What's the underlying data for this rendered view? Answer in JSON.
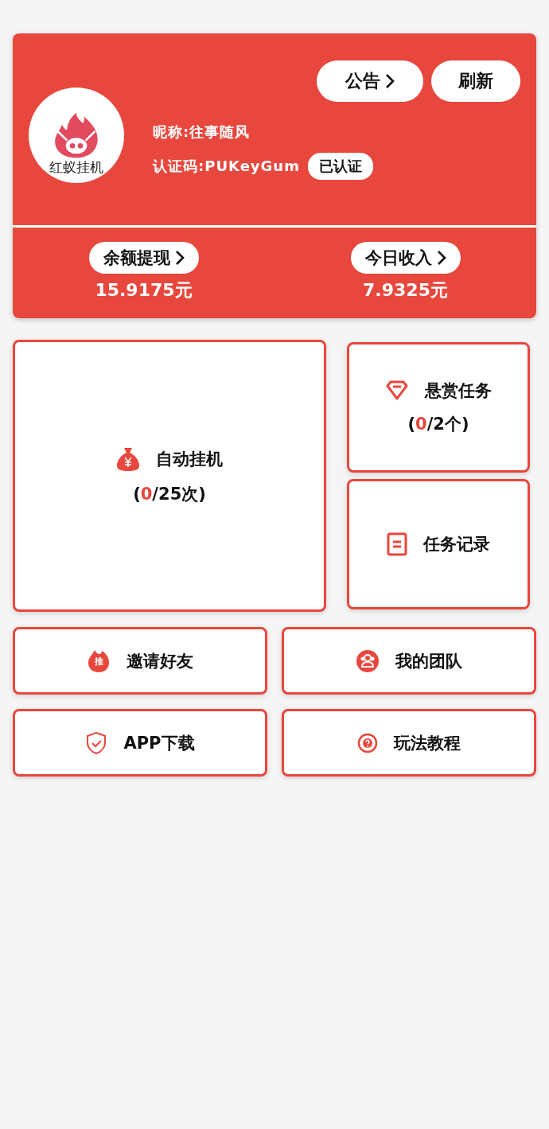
{
  "profile": {
    "logo_text": "红蚁挂机",
    "nickname": "昵称:往事随风",
    "code": "认证码:PUKeyGum",
    "verified_badge": "已认证",
    "buttons": [
      {
        "label": "公告",
        "chevron": true
      },
      {
        "label": "刷新",
        "chevron": false
      }
    ]
  },
  "stats": [
    {
      "label": "余额提现",
      "value": "15.9175元"
    },
    {
      "label": "今日收入",
      "value": "7.9325元"
    }
  ],
  "big_tile": {
    "kind": "money-bag",
    "label": "自动挂机",
    "counter": {
      "before": "(",
      "value": "0",
      "after": "/25次)"
    }
  },
  "side_tiles": [
    {
      "kind": "gem",
      "label": "悬赏任务",
      "counter": {
        "before": "(",
        "value": "0",
        "after": "/2个)"
      }
    },
    {
      "kind": "document",
      "label": "任务记录"
    }
  ],
  "grid_tiles": [
    {
      "kind": "flame-badge",
      "badge_text": "推",
      "label": "邀请好友"
    },
    {
      "kind": "people",
      "label": "我的团队"
    },
    {
      "kind": "shield",
      "label": "APP下载"
    },
    {
      "kind": "question",
      "label": "玩法教程"
    }
  ]
}
